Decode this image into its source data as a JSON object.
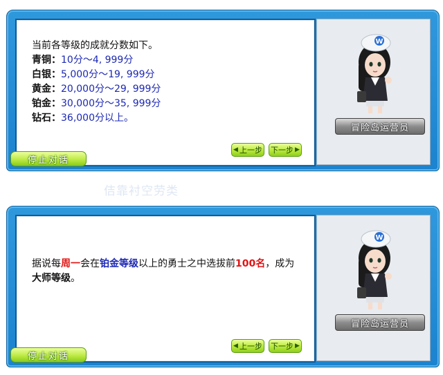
{
  "background_text": "佶靠衬空劳类",
  "dialog1": {
    "intro": "当前各等级的成就分数如下。",
    "tiers": [
      {
        "name": "青铜：",
        "range": "10分～4, 999分"
      },
      {
        "name": "白银：",
        "range": "5,000分～19, 999分"
      },
      {
        "name": "黄金：",
        "range": "20,000分～29, 999分"
      },
      {
        "name": "铂金：",
        "range": "30,000分～35, 999分"
      },
      {
        "name": "钻石：",
        "range": "36,000分以上。"
      }
    ],
    "prev_label": "上一步",
    "next_label": "下一步",
    "npc_name": "冒险岛运营员",
    "stop_label": "停止对话"
  },
  "dialog2": {
    "seg1": "据说每",
    "seg2": "周一",
    "seg3": "会在",
    "seg4": "铂金等级",
    "seg5": "以上的勇士之中选拔前",
    "seg6": "100名",
    "seg7": "，成为",
    "seg8": "大师等级",
    "seg9": "。",
    "prev_label": "上一步",
    "next_label": "下一步",
    "npc_name": "冒险岛运营员",
    "stop_label": "停止对话"
  }
}
